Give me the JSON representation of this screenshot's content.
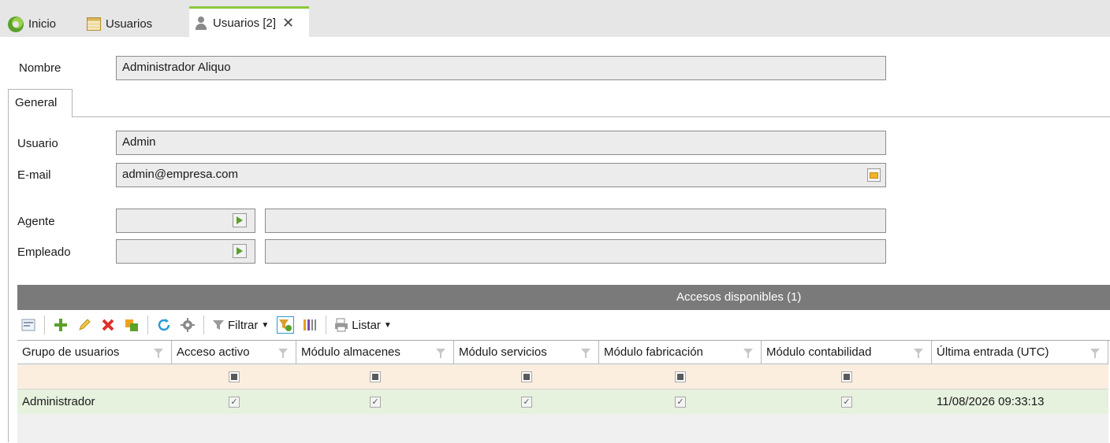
{
  "tabs": [
    {
      "label": "Inicio",
      "icon": "inicio-icon"
    },
    {
      "label": "Usuarios",
      "icon": "grid-icon"
    },
    {
      "label": "Usuarios [2]",
      "icon": "user-icon",
      "active": true
    }
  ],
  "form": {
    "nombre_label": "Nombre",
    "nombre_value": "Administrador Aliquo",
    "section_tab": "General",
    "usuario_label": "Usuario",
    "usuario_value": "Admin",
    "email_label": "E-mail",
    "email_value": "admin@empresa.com",
    "agente_label": "Agente",
    "agente_code": "",
    "agente_name": "",
    "empleado_label": "Empleado",
    "empleado_code": "",
    "empleado_name": ""
  },
  "panel": {
    "title": "Accesos disponibles (1)",
    "toolbar": {
      "filter_label": "Filtrar",
      "list_label": "Listar"
    },
    "columns": [
      "Grupo de usuarios",
      "Acceso activo",
      "Módulo almacenes",
      "Módulo servicios",
      "Módulo fabricación",
      "Módulo contabilidad",
      "Última entrada (UTC)"
    ],
    "rows": [
      {
        "grupo": "Administrador",
        "acceso_activo": true,
        "modulo_almacenes": true,
        "modulo_servicios": true,
        "modulo_fabricacion": true,
        "modulo_contabilidad": true,
        "ultima_entrada": "11/08/2026 09:33:13"
      }
    ]
  },
  "colors": {
    "active_tab_accent": "#8cc63f",
    "panel_header": "#7a7a7a",
    "filter_row": "#fbeedf",
    "selected_row": "#e6f1de"
  }
}
